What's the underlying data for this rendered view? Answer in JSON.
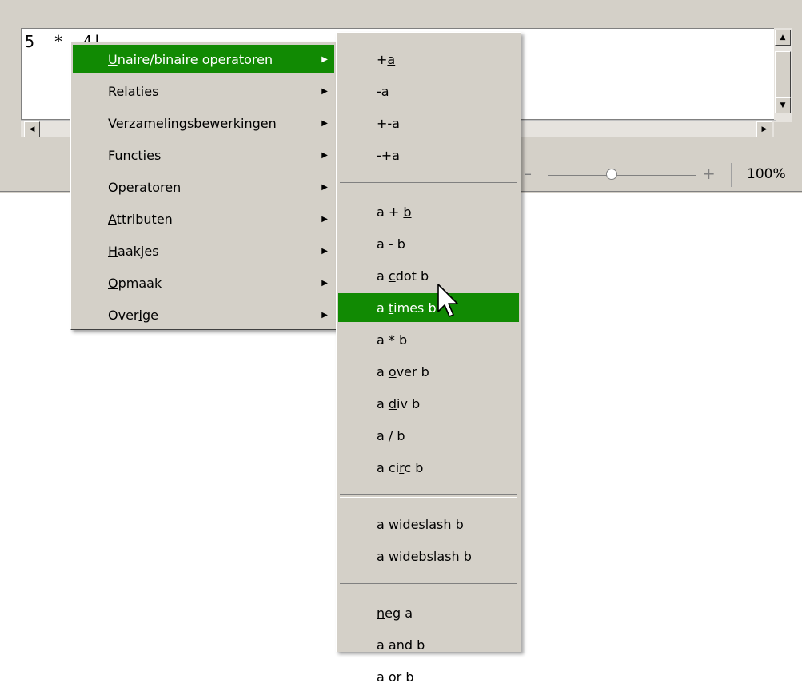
{
  "editor": {
    "formula_text": "5  *  4|"
  },
  "statusbar": {
    "zoom_minus": "–",
    "zoom_plus": "+",
    "zoom_value": "100%",
    "zoom_level_fraction": 0.4
  },
  "menu": {
    "items": [
      {
        "pre": "",
        "u": "U",
        "post": "naire/binaire operatoren",
        "highlighted": true
      },
      {
        "pre": "",
        "u": "R",
        "post": "elaties"
      },
      {
        "pre": "",
        "u": "V",
        "post": "erzamelingsbewerkingen"
      },
      {
        "pre": "",
        "u": "F",
        "post": "uncties"
      },
      {
        "pre": "O",
        "u": "p",
        "post": "eratoren"
      },
      {
        "pre": "",
        "u": "A",
        "post": "ttributen"
      },
      {
        "pre": "",
        "u": "H",
        "post": "aakjes"
      },
      {
        "pre": "",
        "u": "O",
        "post": "pmaak"
      },
      {
        "pre": "Over",
        "u": "i",
        "post": "ge"
      }
    ]
  },
  "submenu": {
    "groups": [
      [
        {
          "pre": "+",
          "u": "a",
          "post": ""
        },
        {
          "pre": "-a",
          "u": "",
          "post": ""
        },
        {
          "pre": "+-a",
          "u": "",
          "post": ""
        },
        {
          "pre": "-+a",
          "u": "",
          "post": ""
        }
      ],
      [
        {
          "pre": "a + ",
          "u": "b",
          "post": ""
        },
        {
          "pre": "a - b",
          "u": "",
          "post": ""
        },
        {
          "pre": "a ",
          "u": "c",
          "post": "dot b"
        },
        {
          "pre": "a ",
          "u": "t",
          "post": "imes b",
          "highlighted": true
        },
        {
          "pre": "a * b",
          "u": "",
          "post": ""
        },
        {
          "pre": "a ",
          "u": "o",
          "post": "ver b"
        },
        {
          "pre": "a ",
          "u": "d",
          "post": "iv b"
        },
        {
          "pre": "a / b",
          "u": "",
          "post": ""
        },
        {
          "pre": "a ci",
          "u": "r",
          "post": "c b"
        }
      ],
      [
        {
          "pre": "a ",
          "u": "w",
          "post": "ideslash b"
        },
        {
          "pre": "a widebs",
          "u": "l",
          "post": "ash b"
        }
      ],
      [
        {
          "pre": "",
          "u": "n",
          "post": "eg a"
        },
        {
          "pre": "a and b",
          "u": "",
          "post": ""
        },
        {
          "pre": "a or b",
          "u": "",
          "post": ""
        }
      ]
    ]
  },
  "colors": {
    "highlight": "#118a03",
    "menu_bg": "#d4d0c8"
  },
  "icons": [
    "arrow-up-icon",
    "arrow-down-icon",
    "arrow-left-icon",
    "arrow-right-icon",
    "submenu-arrow-icon",
    "mouse-cursor-icon"
  ]
}
